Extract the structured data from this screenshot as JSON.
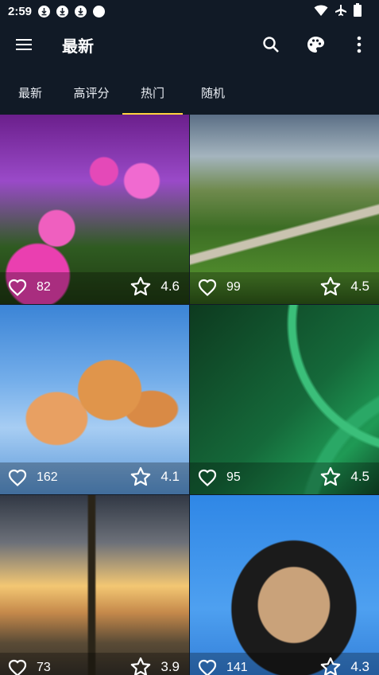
{
  "status_bar": {
    "time": "2:59",
    "notification_icons": [
      "download-icon",
      "download-icon",
      "download-icon",
      "circle-icon"
    ],
    "right_icons": [
      "wifi-icon",
      "airplane-icon",
      "battery-icon"
    ]
  },
  "app_bar": {
    "title": "最新",
    "actions": [
      "search-icon",
      "palette-icon",
      "more-vert-icon"
    ]
  },
  "tabs": [
    {
      "label": "最新",
      "active": false
    },
    {
      "label": "高评分",
      "active": false
    },
    {
      "label": "热门",
      "active": true
    },
    {
      "label": "随机",
      "active": false
    }
  ],
  "accent_color": "#ffd23f",
  "background_color": "#111a26",
  "wallpapers": [
    {
      "image": "pink-flowers",
      "likes": "82",
      "rating": "4.6"
    },
    {
      "image": "green-countryside-path",
      "likes": "99",
      "rating": "4.5"
    },
    {
      "image": "jumping-cat",
      "likes": "162",
      "rating": "4.1"
    },
    {
      "image": "green-abstract-curves",
      "likes": "95",
      "rating": "4.5"
    },
    {
      "image": "eiffel-tower-sunset",
      "likes": "73",
      "rating": "3.9"
    },
    {
      "image": "cat-with-sunglasses",
      "likes": "141",
      "rating": "4.3"
    }
  ]
}
